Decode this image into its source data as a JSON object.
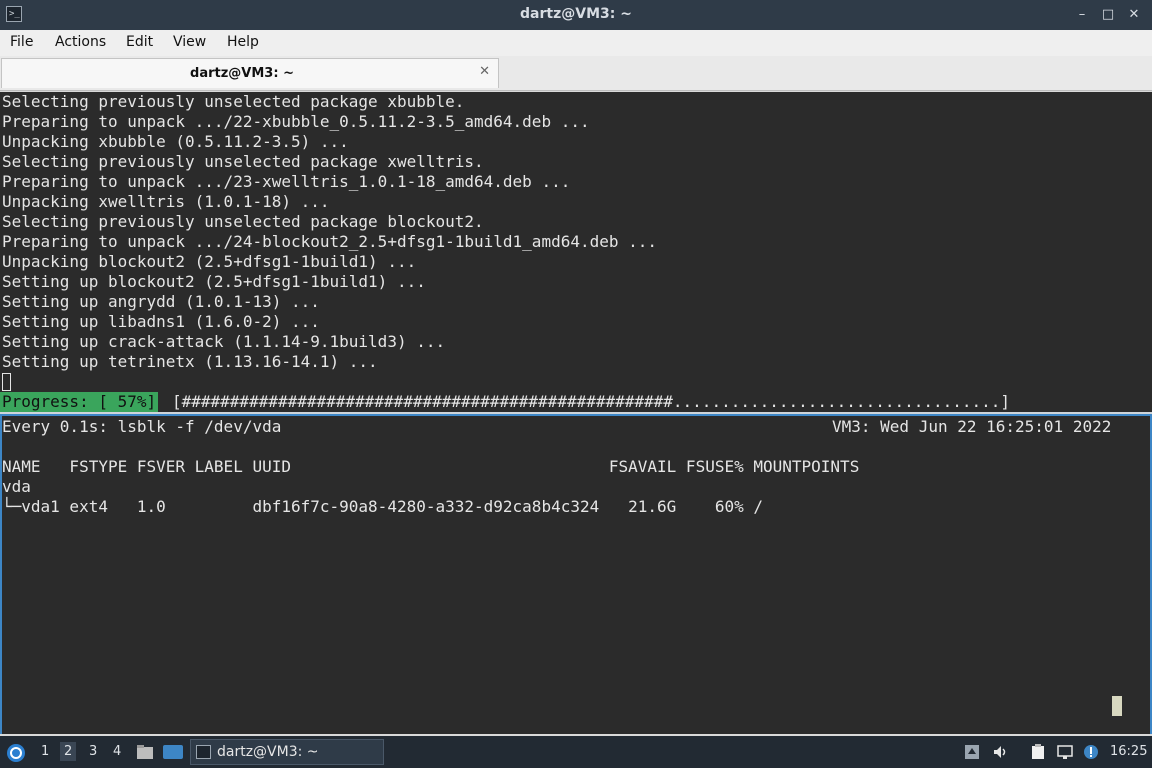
{
  "window": {
    "title": "dartz@VM3: ~",
    "buttons": {
      "minimize": "–",
      "maximize": "□",
      "close": "✕"
    }
  },
  "menu": [
    "File",
    "Actions",
    "Edit",
    "View",
    "Help"
  ],
  "tab": {
    "label": "dartz@VM3: ~",
    "close": "✕"
  },
  "top_pane": {
    "lines": [
      "Selecting previously unselected package xbubble.",
      "Preparing to unpack .../22-xbubble_0.5.11.2-3.5_amd64.deb ...",
      "Unpacking xbubble (0.5.11.2-3.5) ...",
      "Selecting previously unselected package xwelltris.",
      "Preparing to unpack .../23-xwelltris_1.0.1-18_amd64.deb ...",
      "Unpacking xwelltris (1.0.1-18) ...",
      "Selecting previously unselected package blockout2.",
      "Preparing to unpack .../24-blockout2_2.5+dfsg1-1build1_amd64.deb ...",
      "Unpacking blockout2 (2.5+dfsg1-1build1) ...",
      "Setting up blockout2 (2.5+dfsg1-1build1) ...",
      "Setting up angrydd (1.0.1-13) ...",
      "Setting up libadns1 (1.6.0-2) ...",
      "Setting up crack-attack (1.1.14-9.1build3) ...",
      "Setting up tetrinetx (1.13.16-14.1) ..."
    ],
    "progress_label": "Progress: [ 57%]",
    "progress_bar": "[###################################################..................................]",
    "progress_percent": 57
  },
  "bottom_pane": {
    "watch_header": "Every 0.1s: lsblk -f /dev/vda",
    "watch_right": "VM3: Wed Jun 22 16:25:01 2022",
    "table_header": "NAME   FSTYPE FSVER LABEL UUID                                 FSAVAIL FSUSE% MOUNTPOINTS",
    "rows": [
      "vda",
      "└─vda1 ext4   1.0         dbf16f7c-90a8-4280-a332-d92ca8b4c324   21.6G    60% /"
    ]
  },
  "taskbar": {
    "workspaces": [
      "1",
      "2",
      "3",
      "4"
    ],
    "active_workspace": "2",
    "window_button": "dartz@VM3: ~",
    "clock": "16:25",
    "icons": {
      "start": "lubuntu-logo-icon",
      "files": "file-manager-icon",
      "desktop": "show-desktop-icon",
      "tray": [
        "up-arrow-icon",
        "volume-icon",
        "clipboard-icon",
        "network-icon",
        "notification-icon"
      ]
    },
    "colors": {
      "bg": "#222a33",
      "accent": "#3d86c6"
    }
  }
}
